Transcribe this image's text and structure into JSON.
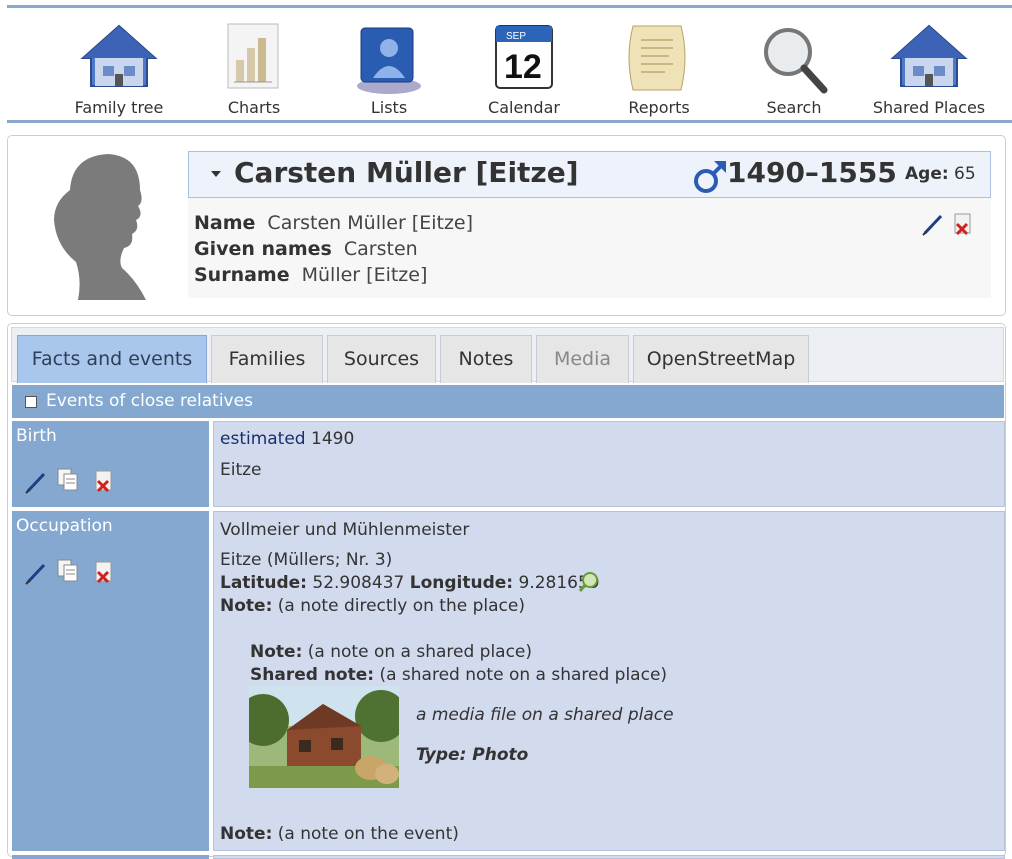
{
  "menu": [
    {
      "label": "Family tree",
      "icon": "house-icon"
    },
    {
      "label": "Charts",
      "icon": "chart-icon"
    },
    {
      "label": "Lists",
      "icon": "lists-icon"
    },
    {
      "label": "Calendar",
      "icon": "calendar-icon"
    },
    {
      "label": "Reports",
      "icon": "scroll-icon"
    },
    {
      "label": "Search",
      "icon": "magnifier-icon"
    },
    {
      "label": "Shared Places",
      "icon": "house-icon"
    }
  ],
  "calendar_icon": {
    "month": "SEP",
    "day": "12"
  },
  "person": {
    "title": "Carsten Müller [Eitze]",
    "dates": "1490–1555",
    "age_label": "Age:",
    "age_value": "65",
    "name_label": "Name",
    "name_value": "Carsten Müller [Eitze]",
    "given_label": "Given names",
    "given_value": "Carsten",
    "surname_label": "Surname",
    "surname_value": "Müller [Eitze]"
  },
  "tabs": [
    {
      "label": "Facts and events",
      "state": "active"
    },
    {
      "label": "Families",
      "state": "normal"
    },
    {
      "label": "Sources",
      "state": "normal"
    },
    {
      "label": "Notes",
      "state": "normal"
    },
    {
      "label": "Media",
      "state": "disabled"
    },
    {
      "label": "OpenStreetMap",
      "state": "normal"
    }
  ],
  "events_toggle": "Events of close relatives",
  "birth": {
    "label": "Birth",
    "date_qualifier": "estimated",
    "date": "1490",
    "place": "Eitze"
  },
  "occupation": {
    "label": "Occupation",
    "value": "Vollmeier und Mühlenmeister",
    "place": "Eitze (Müllers; Nr. 3)",
    "lat_label": "Latitude:",
    "lat_value": "52.908437",
    "lon_label": "Longitude:",
    "lon_value": "9.281659",
    "note_label": "Note:",
    "note_place": "(a note directly on the place)",
    "note_shared_label": "Note:",
    "note_shared": "(a note on a shared place)",
    "shared_note_label": "Shared note:",
    "shared_note": "(a shared note on a shared place)",
    "media_caption": "a media file on a shared place",
    "media_type": "Type: Photo",
    "event_note_label": "Note:",
    "event_note": "(a note on the event)"
  },
  "colors": {
    "accent": "#84a8cf",
    "active_tab": "#a9c6ec",
    "event_body": "#d2daee"
  }
}
